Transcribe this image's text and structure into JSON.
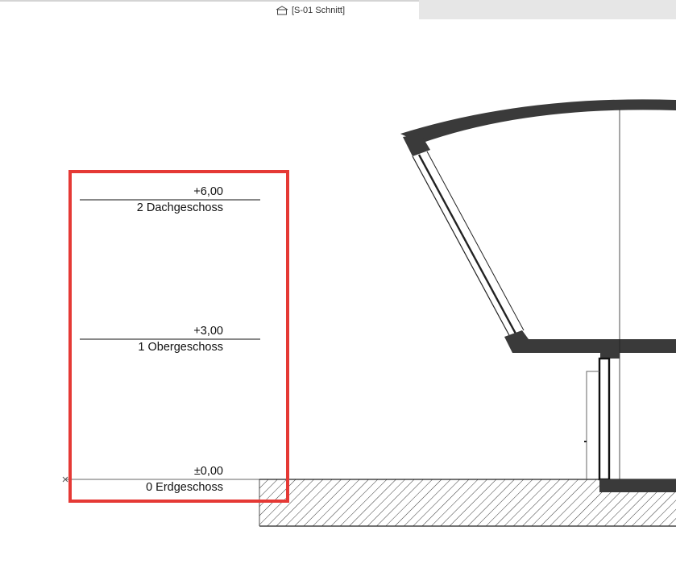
{
  "tab": {
    "title": "[S-01 Schnitt]",
    "icon": "section-house-icon"
  },
  "levels": [
    {
      "elevation": "+6,00",
      "name": "2 Dachgeschoss"
    },
    {
      "elevation": "+3,00",
      "name": "1 Obergeschoss"
    },
    {
      "elevation": "±0,00",
      "name": "0 Erdgeschoss"
    }
  ],
  "colors": {
    "highlight": "#e53935",
    "structure": "#3a3a3a",
    "inactive_tab": "#e6e6e6"
  }
}
